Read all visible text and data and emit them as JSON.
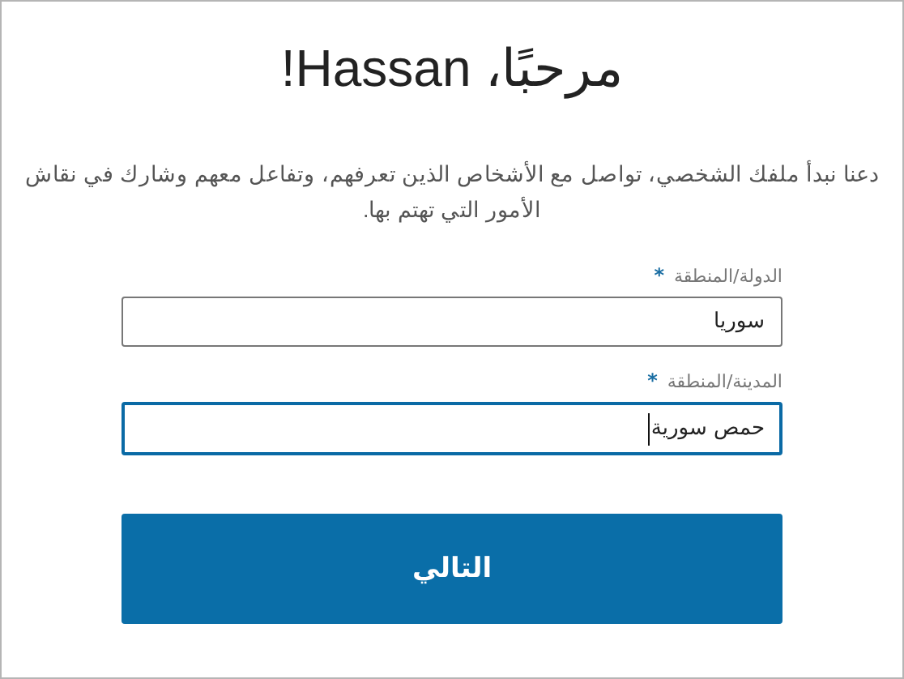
{
  "title": "مرحبًا، Hassan!",
  "intro": "دعنا نبدأ ملفك الشخصي، تواصل مع الأشخاص الذين تعرفهم، وتفاعل معهم وشارك في نقاش الأمور التي تهتم بها.",
  "fields": [
    {
      "label": "الدولة/المنطقة",
      "required_mark": "*",
      "value": "سوريا",
      "focused": false
    },
    {
      "label": "المدينة/المنطقة",
      "required_mark": "*",
      "value": "حمص سورية",
      "focused": true
    }
  ],
  "next_button": "التالي"
}
